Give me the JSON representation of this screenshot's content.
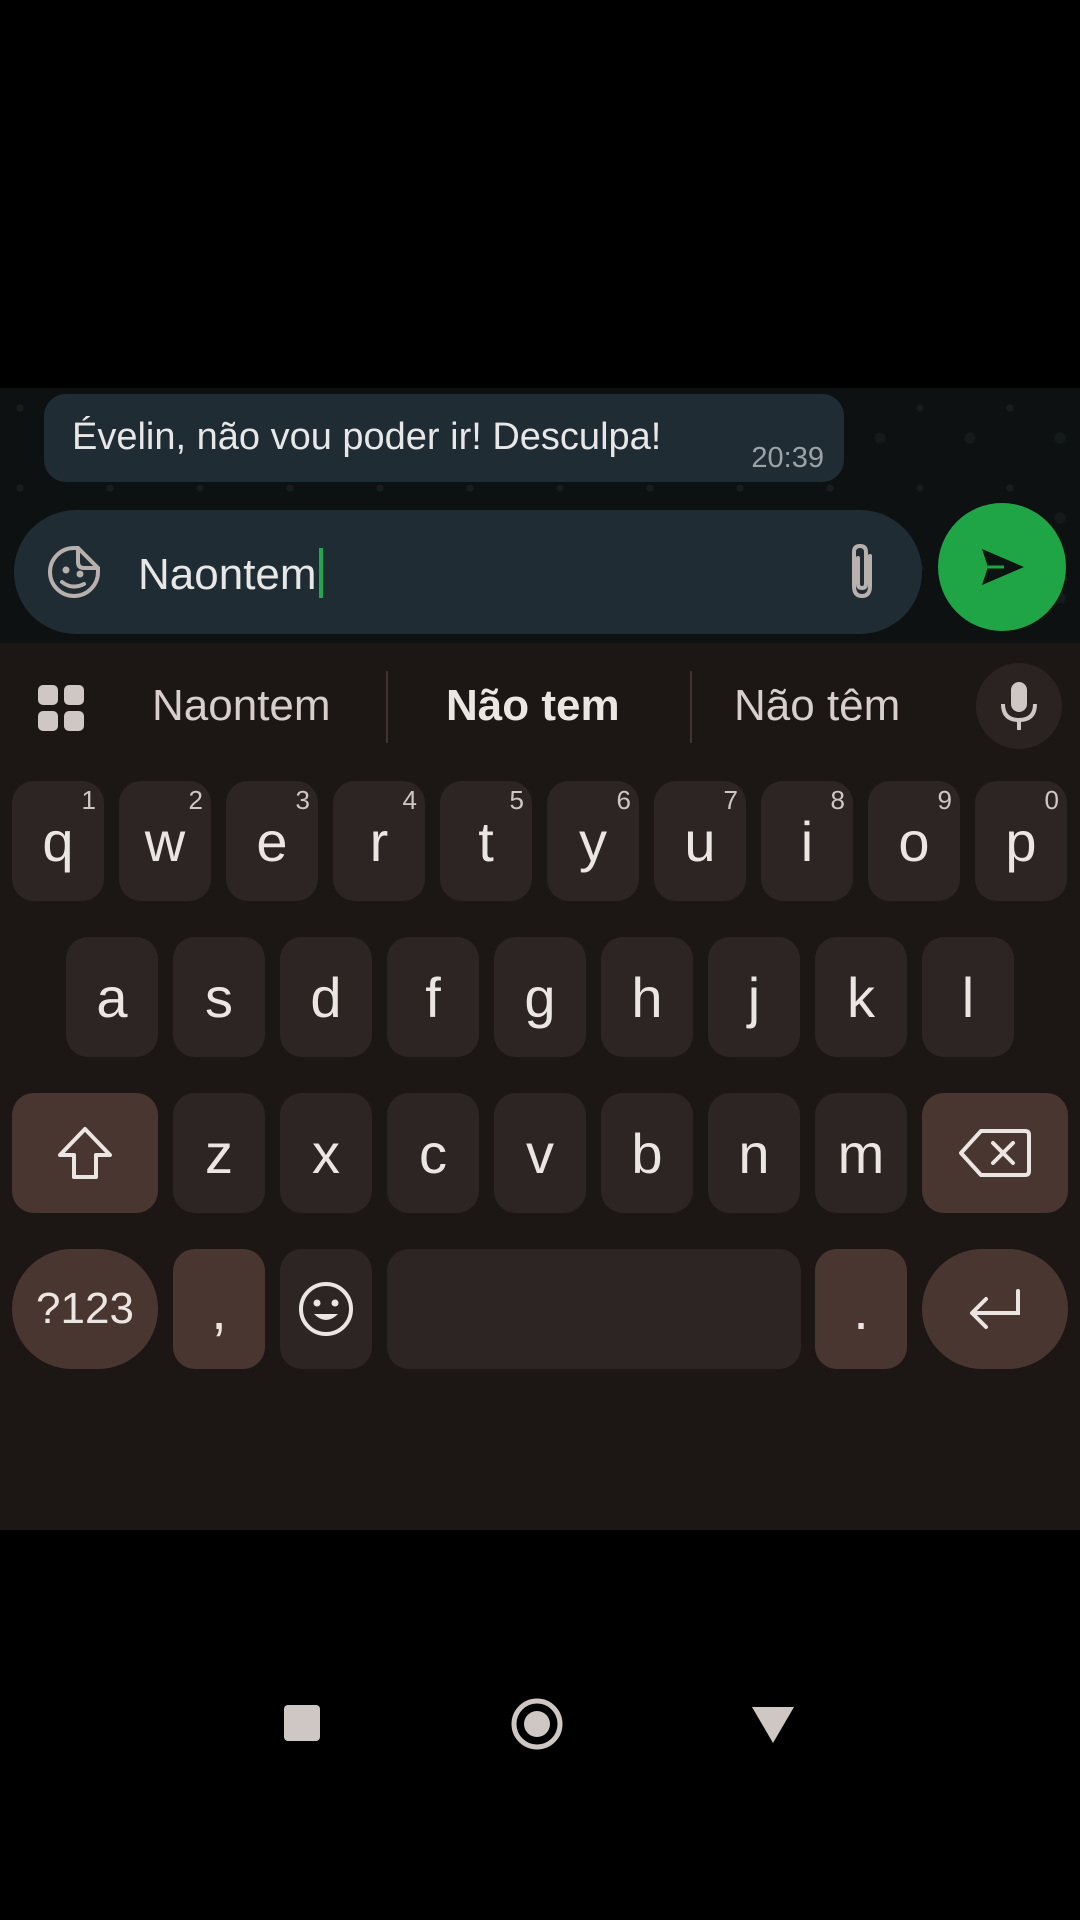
{
  "colors": {
    "accent_green": "#1fa446",
    "bubble": "#1f2c33",
    "key": "#2c2523",
    "modifier_key": "#4a3630"
  },
  "chat": {
    "message_text": "Évelin, não vou poder ir! Desculpa!",
    "message_time": "20:39"
  },
  "composer": {
    "text": "Naontem",
    "emoji_icon": "sticker-icon",
    "attach_icon": "paperclip-icon",
    "send_icon": "send-icon"
  },
  "suggestions": {
    "grid_icon": "apps-grid-icon",
    "items": [
      "Naontem",
      "Não tem",
      "Não têm"
    ],
    "mic_icon": "microphone-icon"
  },
  "keyboard": {
    "row1": [
      {
        "k": "q",
        "h": "1"
      },
      {
        "k": "w",
        "h": "2"
      },
      {
        "k": "e",
        "h": "3"
      },
      {
        "k": "r",
        "h": "4"
      },
      {
        "k": "t",
        "h": "5"
      },
      {
        "k": "y",
        "h": "6"
      },
      {
        "k": "u",
        "h": "7"
      },
      {
        "k": "i",
        "h": "8"
      },
      {
        "k": "o",
        "h": "9"
      },
      {
        "k": "p",
        "h": "0"
      }
    ],
    "row2": [
      "a",
      "s",
      "d",
      "f",
      "g",
      "h",
      "j",
      "k",
      "l"
    ],
    "row3": [
      "z",
      "x",
      "c",
      "v",
      "b",
      "n",
      "m"
    ],
    "shift_icon": "shift-icon",
    "backspace_icon": "backspace-icon",
    "symbols_label": "?123",
    "comma": ",",
    "emoji_icon": "emoji-icon",
    "period": ".",
    "enter_icon": "enter-icon"
  },
  "navbar": {
    "recents_icon": "square-icon",
    "home_icon": "home-circle-icon",
    "back_icon": "back-triangle-icon"
  }
}
